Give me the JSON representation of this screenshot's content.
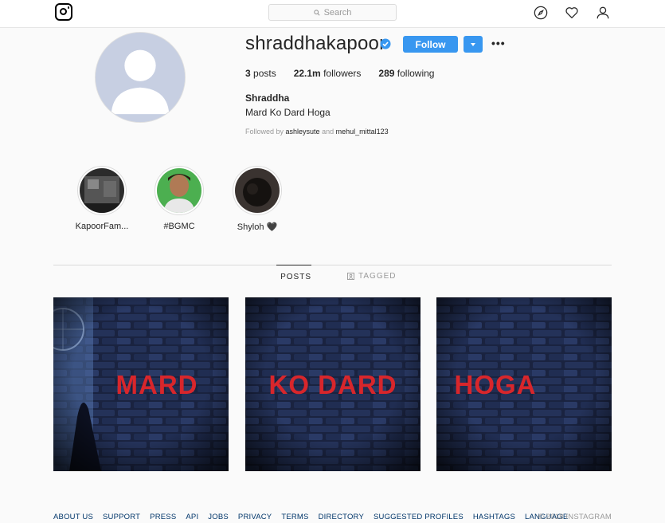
{
  "nav": {
    "search_placeholder": "Search"
  },
  "profile": {
    "username": "shraddhakapoor",
    "follow_label": "Follow",
    "more_label": "•••",
    "stats": [
      {
        "count": "3",
        "label": " posts"
      },
      {
        "count": "22.1m",
        "label": " followers"
      },
      {
        "count": "289",
        "label": " following"
      }
    ],
    "full_name": "Shraddha",
    "bio": "Mard Ko Dard Hoga",
    "followed_by_prefix": "Followed by ",
    "followed_by_user1": "ashleysute",
    "followed_by_joiner": " and ",
    "followed_by_user2": "mehul_mittal123"
  },
  "highlights": [
    {
      "label": "KapoorFam..."
    },
    {
      "label": "#BGMC"
    },
    {
      "label": "Shyloh 🖤"
    }
  ],
  "tabs": {
    "posts": "POSTS",
    "tagged": "TAGGED"
  },
  "posts": [
    {
      "text": "MARD"
    },
    {
      "text": "KO DARD"
    },
    {
      "text": "HOGA"
    }
  ],
  "footer": {
    "links": [
      "ABOUT US",
      "SUPPORT",
      "PRESS",
      "API",
      "JOBS",
      "PRIVACY",
      "TERMS",
      "DIRECTORY",
      "SUGGESTED PROFILES",
      "HASHTAGS",
      "LANGUAGE"
    ],
    "copyright": "© 2018 INSTAGRAM"
  },
  "colors": {
    "accent": "#3897f0",
    "post_text": "#d8262b"
  }
}
